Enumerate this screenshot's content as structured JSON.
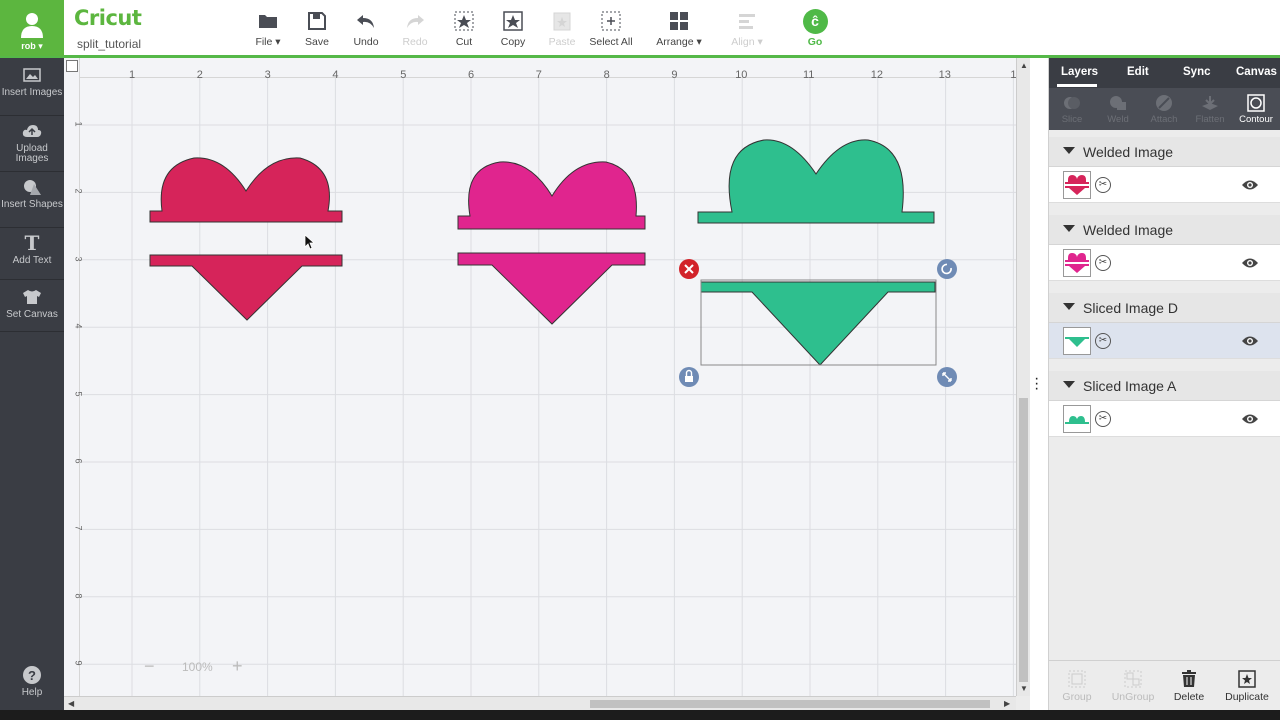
{
  "app": {
    "logo": "Cricut",
    "project_name": "split_tutorial",
    "user": "rob ▾"
  },
  "toolbar": [
    {
      "id": "file",
      "label": "File ▾",
      "icon": "folder-icon",
      "enabled": true
    },
    {
      "id": "save",
      "label": "Save",
      "icon": "save-icon",
      "enabled": true
    },
    {
      "id": "undo",
      "label": "Undo",
      "icon": "undo-icon",
      "enabled": true
    },
    {
      "id": "redo",
      "label": "Redo",
      "icon": "redo-icon",
      "enabled": false
    },
    {
      "id": "cut",
      "label": "Cut",
      "icon": "cut-icon",
      "enabled": true
    },
    {
      "id": "copy",
      "label": "Copy",
      "icon": "copy-icon",
      "enabled": true
    },
    {
      "id": "paste",
      "label": "Paste",
      "icon": "paste-icon",
      "enabled": false
    },
    {
      "id": "select_all",
      "label": "Select All",
      "icon": "select-all-icon",
      "enabled": true
    },
    {
      "id": "arrange",
      "label": "Arrange ▾",
      "icon": "arrange-icon",
      "enabled": true
    },
    {
      "id": "align",
      "label": "Align ▾",
      "icon": "align-icon",
      "enabled": false
    },
    {
      "id": "go",
      "label": "Go",
      "icon": "go-icon",
      "enabled": true
    }
  ],
  "sidebar": [
    {
      "id": "insert_images",
      "label": "Insert Images",
      "icon": "image-icon"
    },
    {
      "id": "upload_images",
      "label": "Upload Images",
      "icon": "cloud-upload-icon"
    },
    {
      "id": "insert_shapes",
      "label": "Insert Shapes",
      "icon": "shapes-icon"
    },
    {
      "id": "add_text",
      "label": "Add Text",
      "icon": "text-icon"
    },
    {
      "id": "set_canvas",
      "label": "Set Canvas",
      "icon": "shirt-icon"
    },
    {
      "id": "help",
      "label": "Help",
      "icon": "help-icon"
    }
  ],
  "canvas": {
    "ruler_top": [
      "1",
      "2",
      "3",
      "4",
      "5",
      "6",
      "7",
      "8",
      "9",
      "10",
      "11",
      "12",
      "13",
      "1"
    ],
    "ruler_left": [
      "1",
      "2",
      "3",
      "4",
      "5",
      "6",
      "7",
      "8",
      "9"
    ],
    "zoom": "100%",
    "colors": {
      "heart1": "#d6245a",
      "heart2": "#e0258e",
      "heart3": "#2ebf8e"
    }
  },
  "panel": {
    "tabs": [
      "Layers",
      "Edit",
      "Sync",
      "Canvas"
    ],
    "tools": [
      {
        "label": "Slice",
        "icon": "slice-icon",
        "enabled": false
      },
      {
        "label": "Weld",
        "icon": "weld-icon",
        "enabled": false
      },
      {
        "label": "Attach",
        "icon": "attach-icon",
        "enabled": false
      },
      {
        "label": "Flatten",
        "icon": "flatten-icon",
        "enabled": false
      },
      {
        "label": "Contour",
        "icon": "contour-icon",
        "enabled": true
      }
    ],
    "layers": [
      {
        "title": "Welded Image",
        "color": "#d6245a",
        "thumb": "full-heart",
        "selected": false
      },
      {
        "title": "Welded Image",
        "color": "#e0258e",
        "thumb": "full-heart",
        "selected": false
      },
      {
        "title": "Sliced Image D",
        "color": "#2ebf8e",
        "thumb": "bottom-piece",
        "selected": true
      },
      {
        "title": "Sliced Image A",
        "color": "#2ebf8e",
        "thumb": "top-piece",
        "selected": false
      }
    ],
    "bottom": [
      {
        "label": "Group",
        "icon": "group-icon",
        "enabled": false
      },
      {
        "label": "UnGroup",
        "icon": "ungroup-icon",
        "enabled": false
      },
      {
        "label": "Delete",
        "icon": "trash-icon",
        "enabled": true
      },
      {
        "label": "Duplicate",
        "icon": "duplicate-icon",
        "enabled": true
      }
    ]
  }
}
